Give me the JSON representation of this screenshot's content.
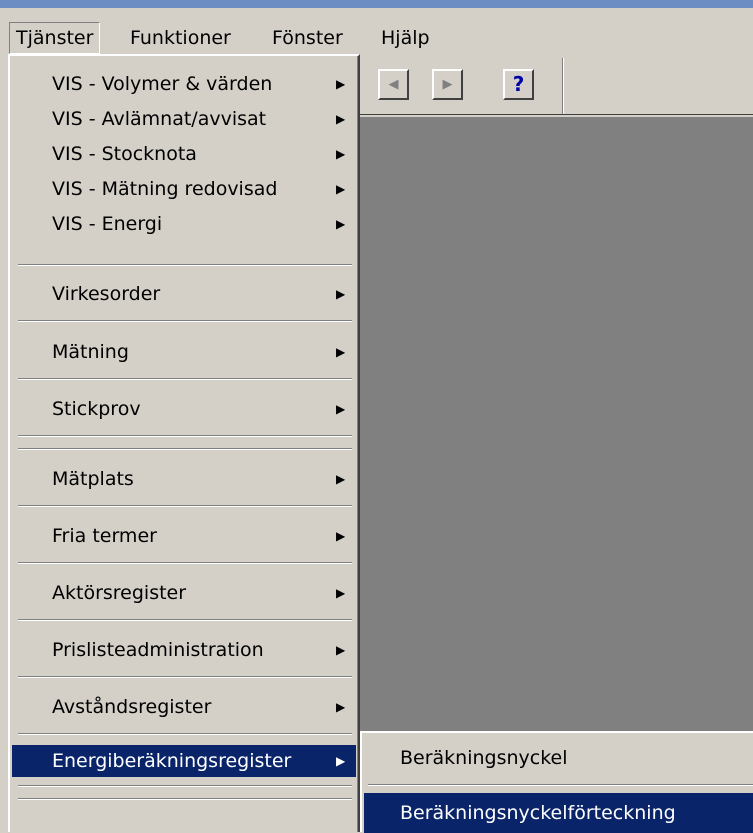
{
  "menubar": {
    "items": [
      {
        "label": "Tjänster"
      },
      {
        "label": "Funktioner"
      },
      {
        "label": "Fönster"
      },
      {
        "label": "Hjälp"
      }
    ]
  },
  "toolbar": {
    "help_label": "?"
  },
  "menu": {
    "items": [
      {
        "label": "VIS - Volymer & värden",
        "has_submenu": true
      },
      {
        "label": "VIS - Avlämnat/avvisat",
        "has_submenu": true
      },
      {
        "label": "VIS - Stocknota",
        "has_submenu": true
      },
      {
        "label": "VIS - Mätning redovisad",
        "has_submenu": true
      },
      {
        "label": "VIS - Energi",
        "has_submenu": true
      },
      {
        "label": "Virkesorder",
        "has_submenu": true
      },
      {
        "label": "Mätning",
        "has_submenu": true
      },
      {
        "label": "Stickprov",
        "has_submenu": true
      },
      {
        "label": "Mätplats",
        "has_submenu": true
      },
      {
        "label": "Fria termer",
        "has_submenu": true
      },
      {
        "label": "Aktörsregister",
        "has_submenu": true
      },
      {
        "label": "Prislisteadministration",
        "has_submenu": true
      },
      {
        "label": "Avståndsregister",
        "has_submenu": true
      },
      {
        "label": "Energiberäkningsregister",
        "has_submenu": true,
        "selected": true
      }
    ],
    "submenu_glyph": "▶"
  },
  "submenu": {
    "items": [
      {
        "label": "Beräkningsnyckel"
      },
      {
        "label": "Beräkningsnyckelförteckning",
        "selected": true
      }
    ]
  },
  "colors": {
    "face": "#d4d0c8",
    "workspace": "#808080",
    "selection": "#0a246a",
    "title_strip": "#6c8cc4"
  }
}
